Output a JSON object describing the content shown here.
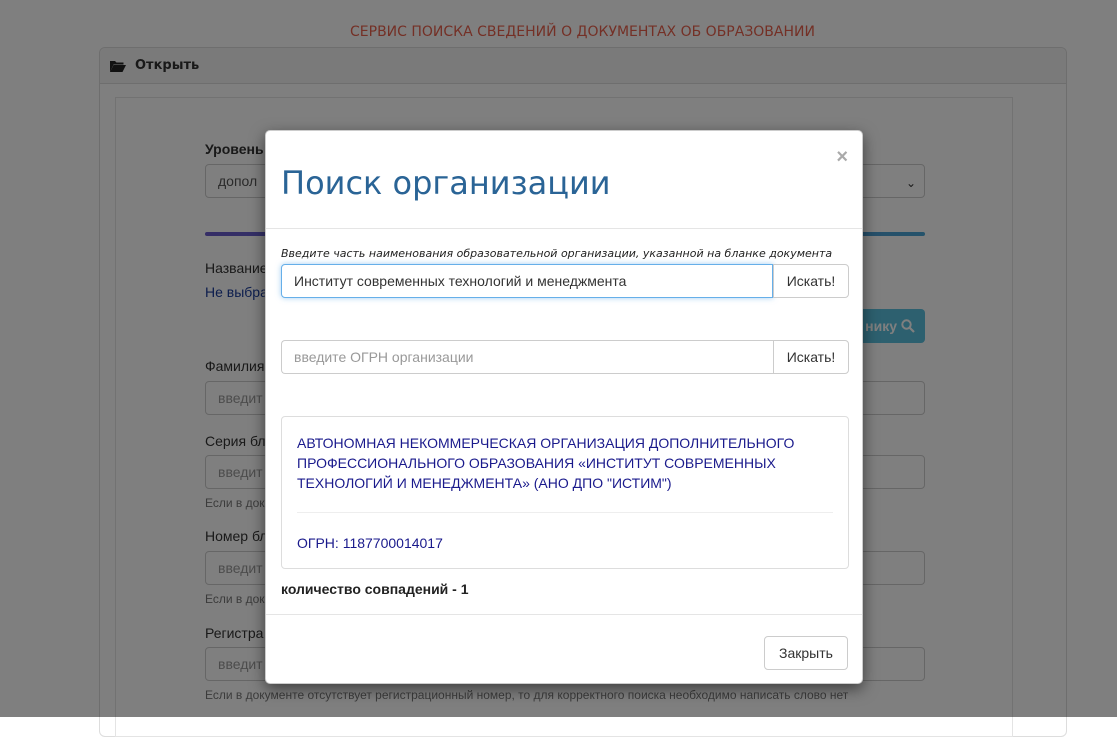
{
  "service_title": "СЕРВИС ПОИСКА СВЕДЕНИЙ О ДОКУМЕНТАХ ОБ ОБРАЗОВАНИИ",
  "panel": {
    "heading": "Открыть"
  },
  "form": {
    "level_label": "Уровень",
    "level_value": "допол",
    "name_label": "Название",
    "not_selected": "Не выбра",
    "search_by_button": "нику",
    "surname_label": "Фамилия",
    "surname_placeholder": "введит",
    "series_label": "Серия бл",
    "series_placeholder": "введит",
    "series_hint": "Если в док",
    "number_label": "Номер бл",
    "number_placeholder": "введит",
    "number_hint": "Если в док",
    "reg_label": "Регистра",
    "reg_placeholder": "введит",
    "reg_hint": "Если в документе отсутствует регистрационный номер, то для корректного поиска необходимо написать слово нет"
  },
  "modal": {
    "title": "Поиск организации",
    "close_symbol": "×",
    "hint": "Введите часть наименования образовательной организации, указанной на бланке документа",
    "name_search": {
      "value": "Институт современных технологий и менеджмента",
      "button": "Искать!"
    },
    "ogrn_search": {
      "placeholder": "введите ОГРН организации",
      "button": "Искать!"
    },
    "result": {
      "name": "АВТОНОМНАЯ НЕКОММЕРЧЕСКАЯ ОРГАНИЗАЦИЯ ДОПОЛНИТЕЛЬНОГО ПРОФЕССИОНАЛЬНОГО ОБРАЗОВАНИЯ «ИНСТИТУТ СОВРЕМЕННЫХ ТЕХНОЛОГИЙ И МЕНЕДЖМЕНТА» (АНО ДПО \"ИСТИМ\")",
      "ogrn": "ОГРН: 1187700014017"
    },
    "match_count": "количество совпадений - 1",
    "close_button": "Закрыть"
  },
  "colors": {
    "title": "#e8604c",
    "modal_title": "#2a6496",
    "result_text": "#1a1a8c",
    "accent": "#5bc0de"
  }
}
